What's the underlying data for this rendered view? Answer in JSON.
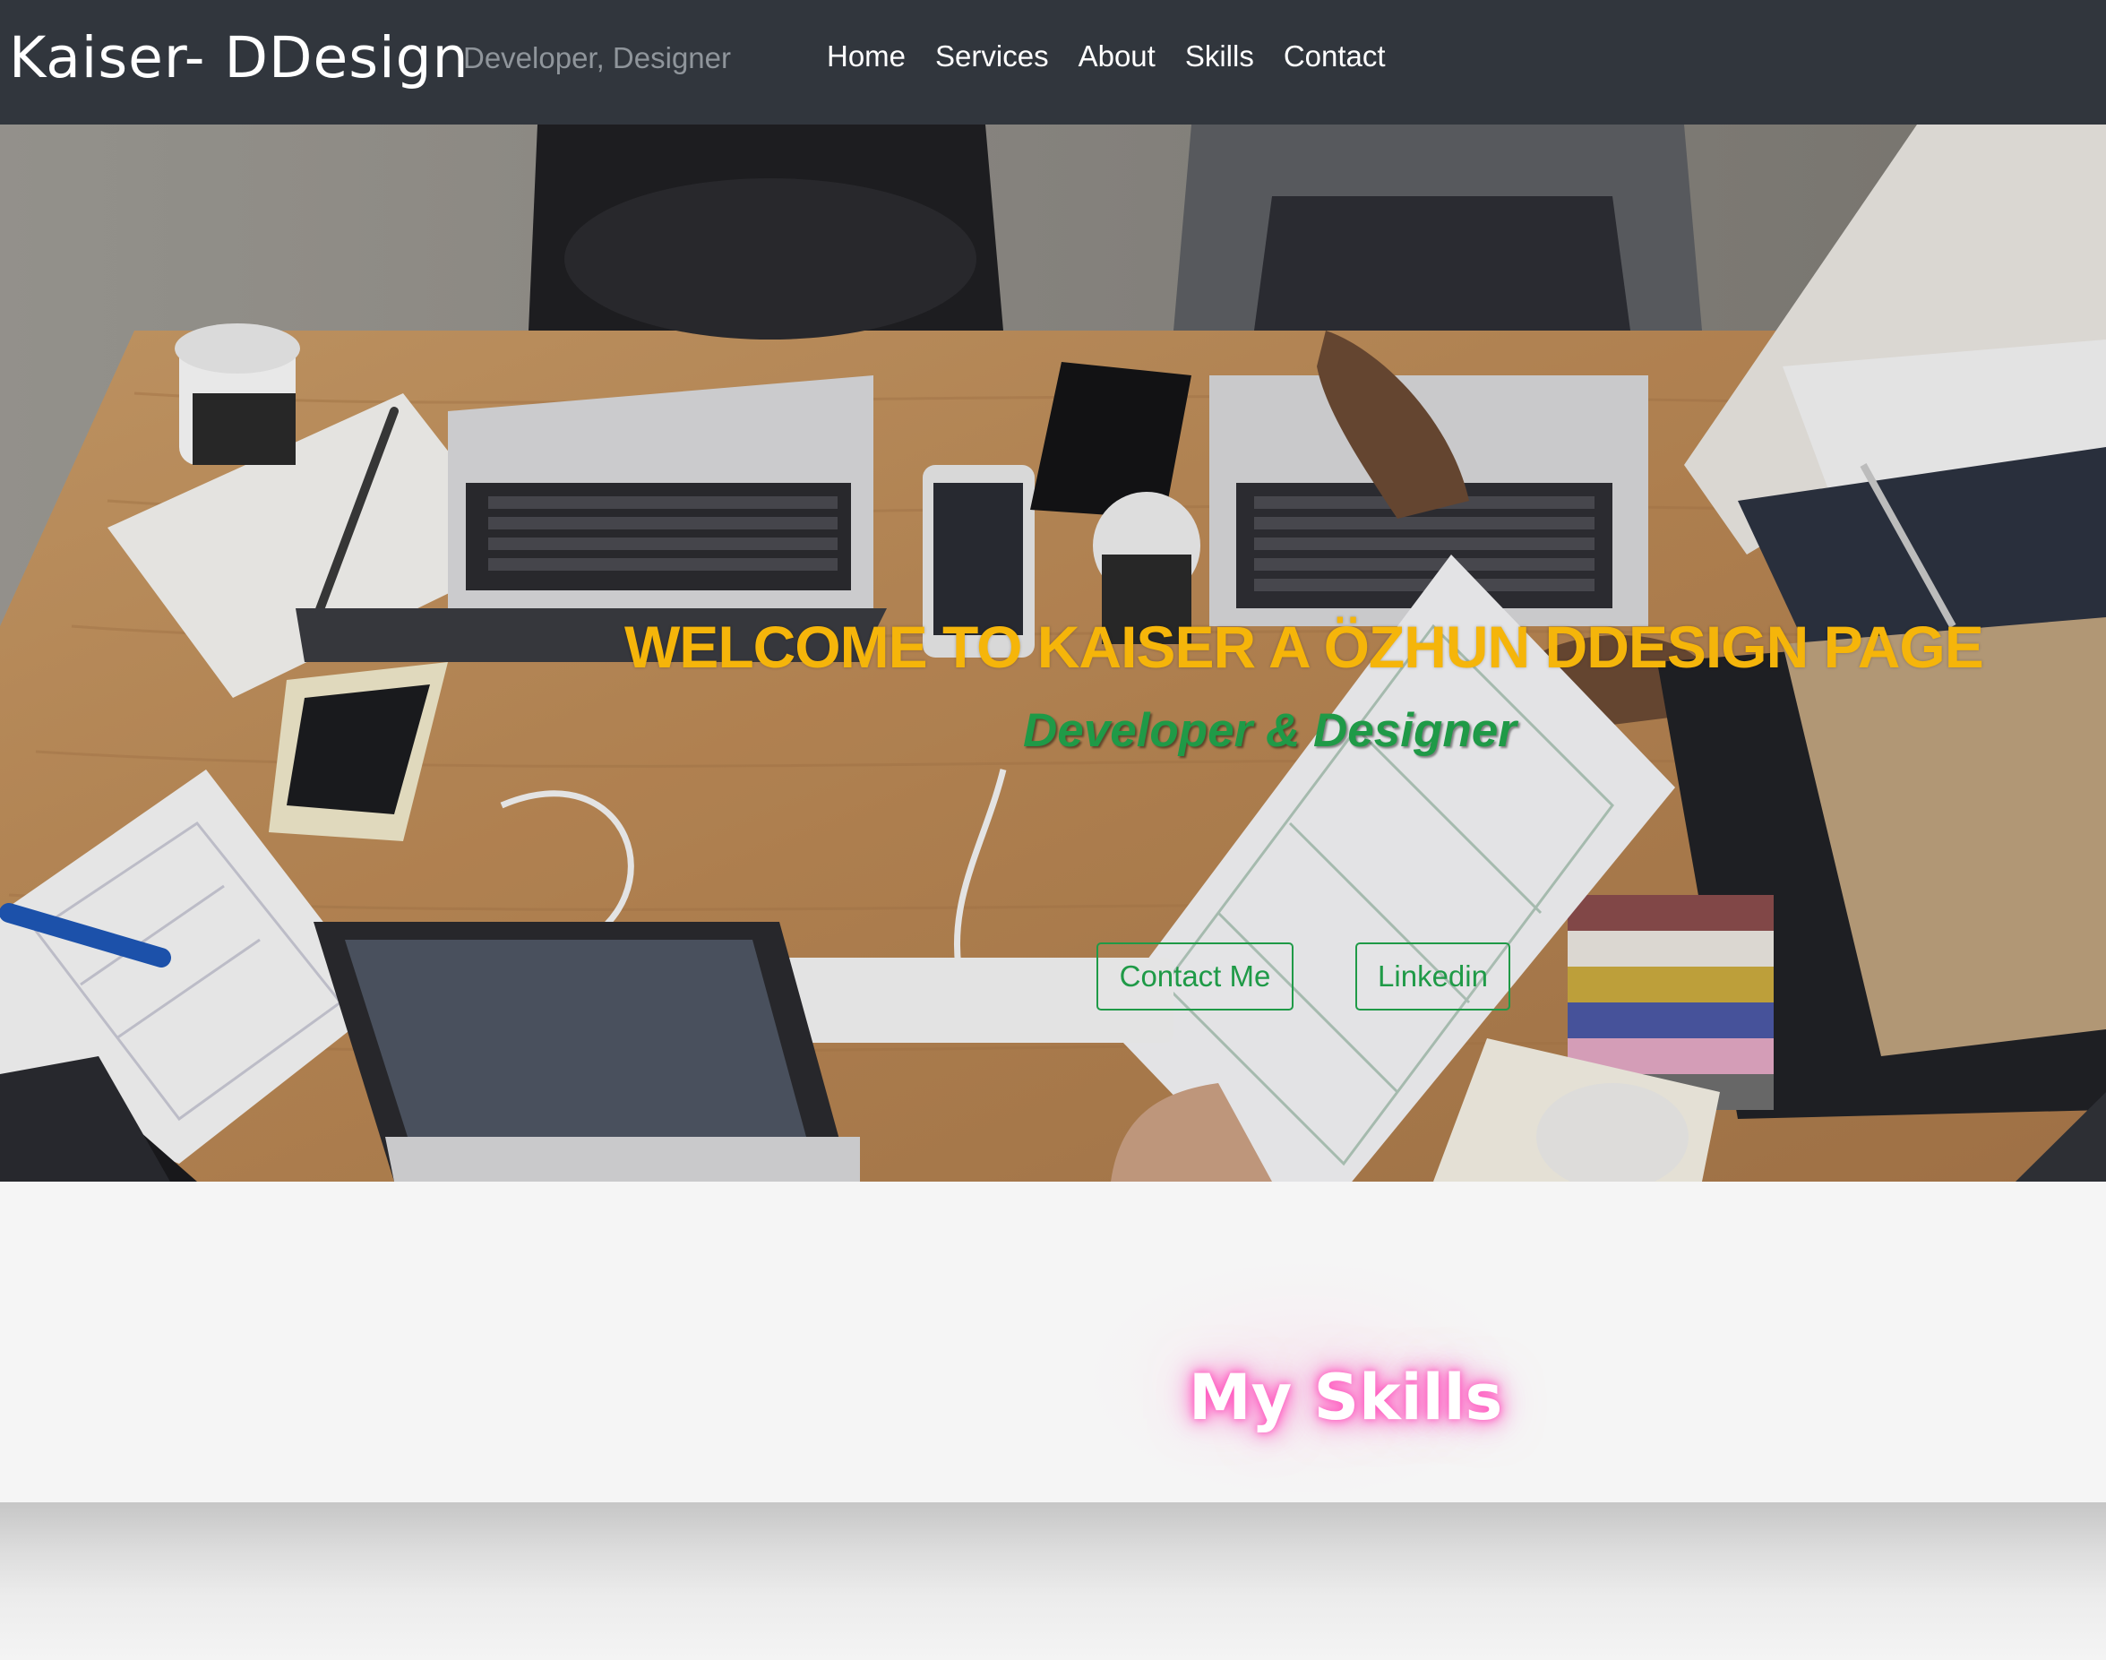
{
  "navbar": {
    "brand": "Kaiser- DDesign",
    "tagline": "Developer, Designer",
    "links": [
      "Home",
      "Services",
      "About",
      "Skills",
      "Contact"
    ]
  },
  "hero": {
    "title": "WELCOME TO KAISER A ÖZHUN DDESIGN PAGE",
    "subtitle": "Developer & Designer",
    "buttons": {
      "contact": "Contact Me",
      "linkedin": "Linkedin"
    }
  },
  "skills": {
    "title": "My Skills"
  },
  "colors": {
    "navbar_bg": "#31363d",
    "title_accent": "#f5b50a",
    "green_accent": "#1f9a47",
    "neon_pink": "#ff5cc0"
  }
}
